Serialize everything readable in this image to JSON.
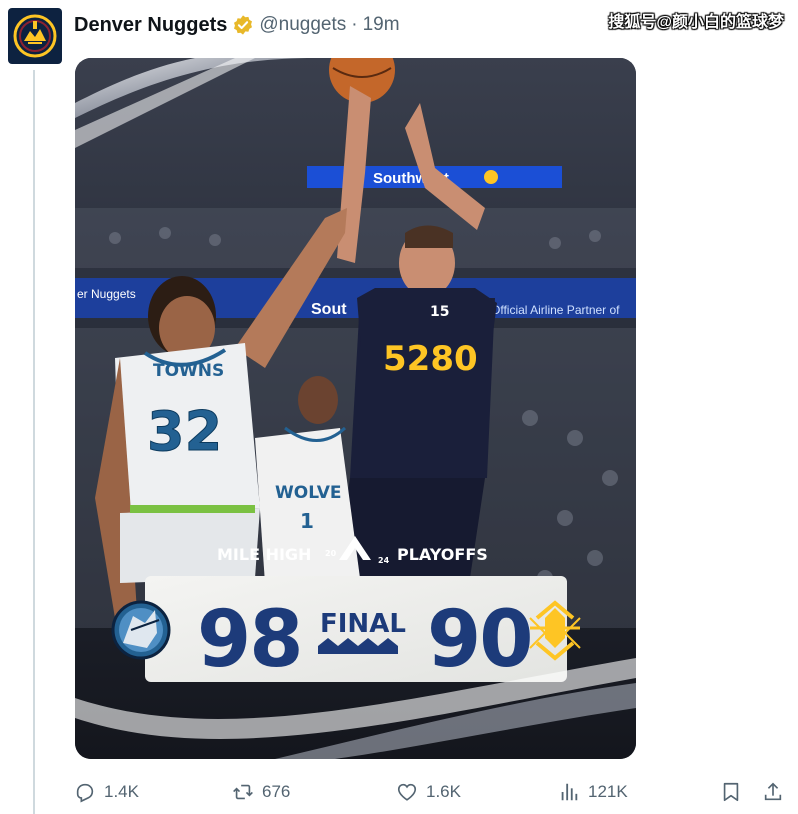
{
  "tweet": {
    "name": "Denver Nuggets",
    "handle": "@nuggets",
    "separator": "·",
    "time": "19m"
  },
  "watermark": "搜狐号@颜小白的篮球梦",
  "graphic": {
    "event_left": "MILE HIGH",
    "year_top": "20",
    "year_bottom": "24",
    "event_right": "PLAYOFFS",
    "away_score": "98",
    "status": "FINAL",
    "home_score": "90",
    "arena_banner_top": "Southwest",
    "arena_banner_left": "er Nuggets",
    "arena_banner_mid": "Sout",
    "arena_banner_right": "Official Airline Partner of",
    "jersey_left_name": "TOWNS",
    "jersey_left_number": "32",
    "jersey_center": "5280",
    "jersey_center_number": "15",
    "jersey_right_name": "WOLVE",
    "jersey_right_number": "1"
  },
  "actions": {
    "replies": "1.4K",
    "reposts": "676",
    "likes": "1.6K",
    "views": "121K"
  },
  "colors": {
    "nuggets_navy": "#0d2240",
    "nuggets_gold": "#fec524",
    "wolves_blue": "#236192",
    "score_blue": "#1d3b7a",
    "muted_text": "#536471",
    "verified_gold": "#e8b829"
  },
  "icons": [
    "nuggets-logo-icon",
    "verified-badge-icon",
    "reply-icon",
    "repost-icon",
    "like-icon",
    "views-icon",
    "bookmark-icon",
    "share-icon",
    "timberwolves-logo-icon",
    "nuggets-team-logo-icon"
  ]
}
